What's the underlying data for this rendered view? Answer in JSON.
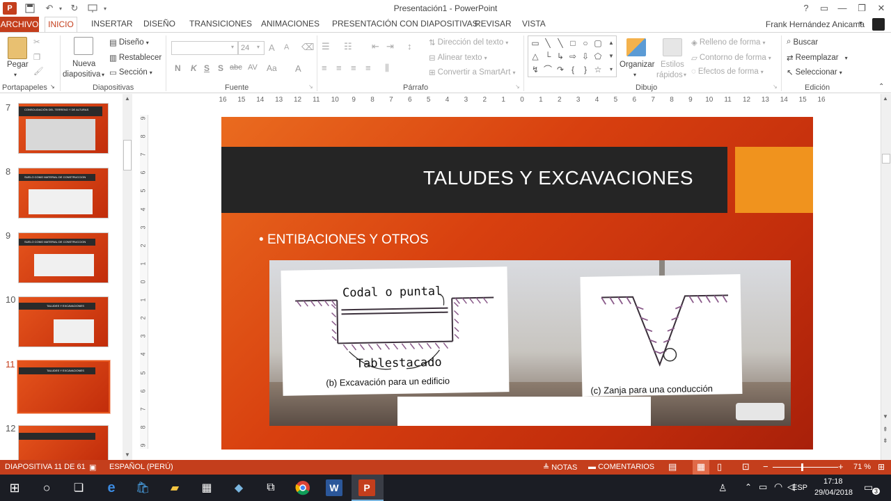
{
  "window": {
    "title": "Presentación1 - PowerPoint",
    "app_letter": "P",
    "help": "?",
    "minimize": "—",
    "restore": "❐",
    "close": "✕"
  },
  "menu": {
    "file": "ARCHIVO",
    "tabs": [
      "INICIO",
      "INSERTAR",
      "DISEÑO",
      "TRANSICIONES",
      "ANIMACIONES",
      "PRESENTACIÓN CON DIAPOSITIVAS",
      "REVISAR",
      "VISTA"
    ],
    "user": "Frank Hernández Anicama"
  },
  "ribbon": {
    "clipboard": {
      "paste": "Pegar",
      "label": "Portapapeles"
    },
    "slides": {
      "new_line1": "Nueva",
      "new_line2": "diapositiva",
      "layout": "Diseño",
      "reset": "Restablecer",
      "section": "Sección",
      "label": "Diapositivas"
    },
    "font": {
      "size": "24",
      "bold": "N",
      "italic": "K",
      "underline": "S",
      "shadow": "S",
      "strike": "abc",
      "spacing": "AV",
      "case": "Aa",
      "color": "A",
      "grow": "A",
      "shrink": "A",
      "label": "Fuente"
    },
    "paragraph": {
      "direction": "Dirección del texto",
      "align": "Alinear texto",
      "smartart": "Convertir a SmartArt",
      "label": "Párrafo"
    },
    "drawing": {
      "arrange": "Organizar",
      "styles_line1": "Estilos",
      "styles_line2": "rápidos",
      "fill": "Relleno de forma",
      "outline": "Contorno de forma",
      "effects": "Efectos de forma",
      "label": "Dibujo"
    },
    "editing": {
      "find": "Buscar",
      "replace": "Reemplazar",
      "select": "Seleccionar",
      "label": "Edición"
    }
  },
  "ruler": {
    "h_ticks": [
      "16",
      "15",
      "14",
      "13",
      "12",
      "11",
      "10",
      "9",
      "8",
      "7",
      "6",
      "5",
      "4",
      "3",
      "2",
      "1",
      "0",
      "1",
      "2",
      "3",
      "4",
      "5",
      "6",
      "7",
      "8",
      "9",
      "10",
      "11",
      "12",
      "13",
      "14",
      "15",
      "16"
    ],
    "v_ticks": [
      "9",
      "8",
      "7",
      "6",
      "5",
      "4",
      "3",
      "2",
      "1",
      "0",
      "1",
      "2",
      "3",
      "4",
      "5",
      "6",
      "7",
      "8",
      "9"
    ]
  },
  "thumbnails": [
    {
      "num": "7",
      "title": "CONSOLIDACIÓN DEL TERRENO Y DE ALTURAS"
    },
    {
      "num": "8",
      "title": "SUELO COMO MATERIAL DE CONSTRUCCION"
    },
    {
      "num": "9",
      "title": "SUELO COMO MATERIAL DE CONSTRUCCION"
    },
    {
      "num": "10",
      "title": "TALUDES Y EXCAVACIONES"
    },
    {
      "num": "11",
      "title": "TALUDES Y EXCAVACIONES"
    },
    {
      "num": "12",
      "title": ""
    }
  ],
  "slide": {
    "title": "TALUDES Y  EXCAVACIONES",
    "bullet": "ENTIBACIONES Y OTROS",
    "diagram": {
      "codal": "Codal o puntal",
      "tablestacado": "Tablestacado",
      "caption_b": "(b) Excavación para un edificio",
      "caption_c": "(c) Zanja para una conducción"
    }
  },
  "status": {
    "slide_info": "DIAPOSITIVA 11 DE 61",
    "language": "ESPAÑOL (PERÚ)",
    "notes": "NOTAS",
    "comments": "COMENTARIOS",
    "zoom": "71 %",
    "zoom_level": 0.45
  },
  "taskbar": {
    "language": "ESP",
    "time": "17:18",
    "date": "29/04/2018",
    "notifications": "3"
  },
  "colors": {
    "accent": "#c43e1c",
    "slide_orange": "#e5541c",
    "title_band": "#252525",
    "title_accent": "#f0931e"
  }
}
